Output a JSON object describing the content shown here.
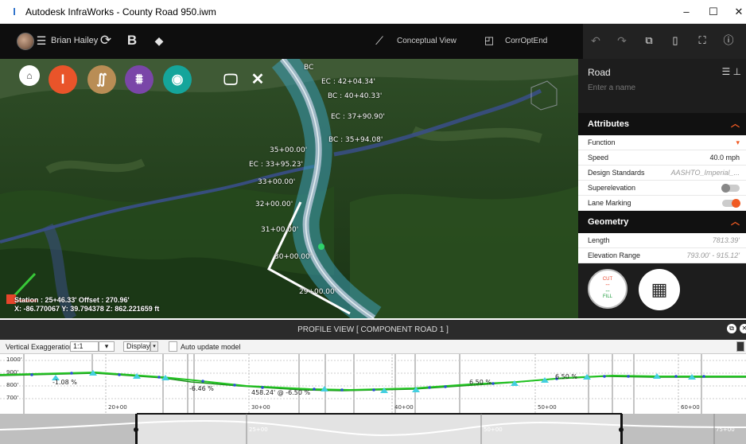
{
  "window": {
    "app_icon": "I",
    "title": "Autodesk InfraWorks - County Road 950.iwm",
    "minimize": "–",
    "maximize": "☐",
    "close": "✕"
  },
  "toolbar": {
    "user_name": "Brian Hailey",
    "view_mode": "Conceptual View",
    "proposal": "CorrOptEnd"
  },
  "viewport": {
    "labels": [
      "BC",
      "EC : 42+04.34'",
      "BC : 40+40.33'",
      "EC : 37+90.90'",
      "BC : 35+94.08'",
      "35+00.00'",
      "EC : 33+95.23'",
      "33+00.00'",
      "32+00.00'",
      "31+00.00'",
      "30+00.00'",
      "29+00.00'"
    ],
    "station_readout": "Station : 25+46.33' Offset : 270.96'",
    "xyz_readout": "X: -86.770067 Y: 39.794378 Z: 862.221659 ft"
  },
  "panel": {
    "title": "Road",
    "name_placeholder": "Enter a name",
    "attributes_header": "Attributes",
    "attributes": [
      {
        "label": "Function",
        "value": ""
      },
      {
        "label": "Speed",
        "value": "40.0 mph"
      },
      {
        "label": "Design Standards",
        "value": "AASHTO_Imperial_..."
      },
      {
        "label": "Superelevation",
        "value": ""
      },
      {
        "label": "Lane Marking",
        "value": ""
      }
    ],
    "geometry_header": "Geometry",
    "geometry": [
      {
        "label": "Length",
        "value": "7813.39'"
      },
      {
        "label": "Elevation Range",
        "value": "793.00' - 915.12'"
      }
    ],
    "cut_label": "CUT",
    "cut_value": "--",
    "fill_value": "--",
    "fill_label": "FILL"
  },
  "profile": {
    "header": "PROFILE VIEW [ COMPONENT ROAD 1 ]",
    "vertical_exaggeration_label": "Vertical Exaggeration",
    "vertical_exaggeration_value": "1:1",
    "display_label": "Display",
    "auto_update_label": "Auto update model",
    "elev_ticks": [
      "1000'",
      "900'",
      "800'",
      "700'"
    ],
    "station_ticks": [
      "20+00",
      "30+00",
      "40+00",
      "50+00",
      "60+00"
    ],
    "grade_labels": [
      "-1.08 %",
      "-6.46 %",
      "458.24' @ -6.50 %",
      "6.50 %",
      "6.50 %"
    ],
    "nav_station_ticks": [
      "25+00",
      "50+00",
      "75+00"
    ]
  },
  "colors": {
    "accent": "#f05a22",
    "profile_line": "#22c322",
    "alignment": "#4aa8c8"
  }
}
